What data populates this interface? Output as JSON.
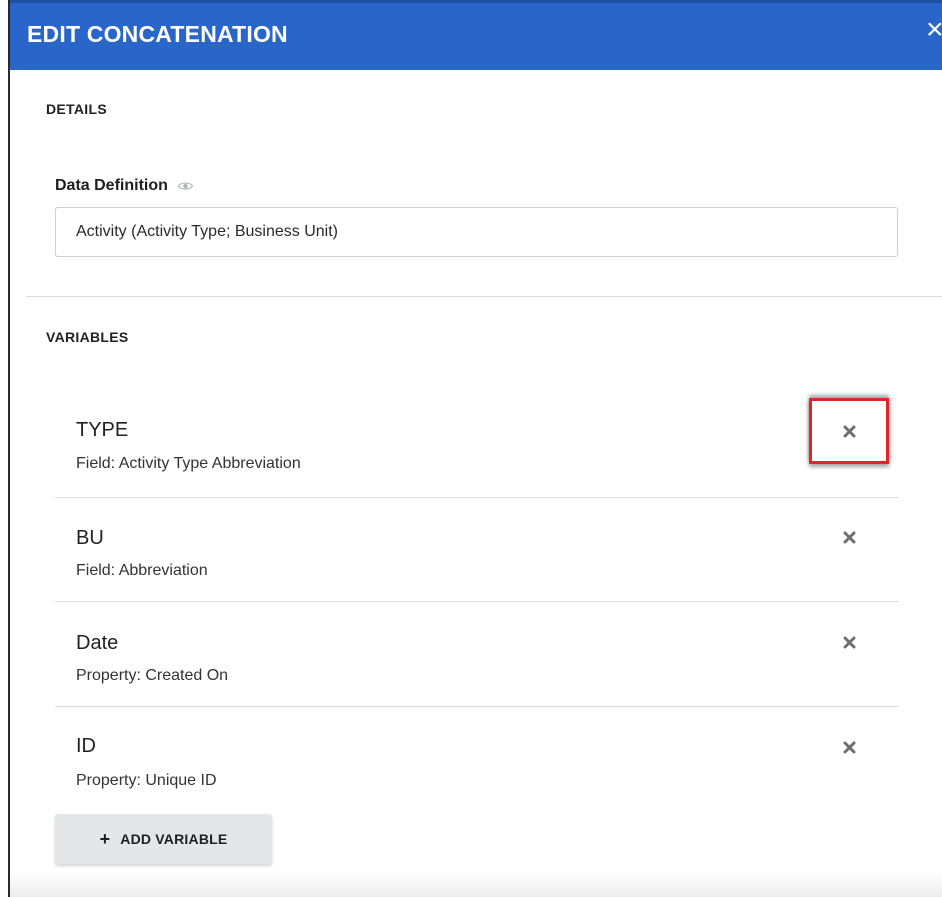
{
  "header": {
    "title": "EDIT CONCATENATION",
    "close_glyph": "×"
  },
  "details": {
    "section_label": "DETAILS",
    "data_definition_label": "Data Definition",
    "data_definition_value": "Activity (Activity Type; Business Unit)"
  },
  "variables": {
    "section_label": "VARIABLES",
    "items": [
      {
        "name": "TYPE",
        "source": "Field: Activity Type Abbreviation"
      },
      {
        "name": "BU",
        "source": "Field: Abbreviation"
      },
      {
        "name": "Date",
        "source": "Property: Created On"
      },
      {
        "name": "ID",
        "source": "Property: Unique ID"
      }
    ],
    "add_button_icon": "+",
    "add_button_label": "ADD VARIABLE"
  },
  "icons": {
    "visibility": "eye-icon",
    "remove": "x-icon",
    "add": "plus-icon"
  },
  "colors": {
    "header_bg": "#2a66c9",
    "highlight_border": "#e0252b",
    "icon_gray": "#6b6e72",
    "button_bg": "#e4e6e9"
  }
}
